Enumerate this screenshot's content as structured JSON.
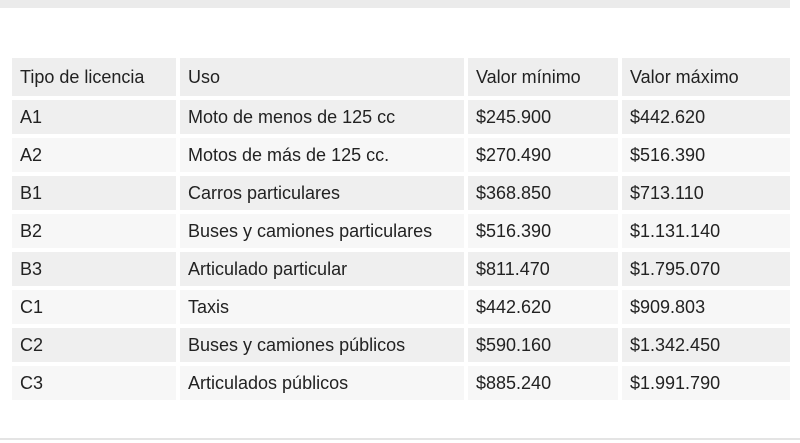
{
  "table": {
    "headers": [
      "Tipo de licencia",
      "Uso",
      "Valor mínimo",
      "Valor máximo"
    ],
    "rows": [
      [
        "A1",
        "Moto de menos de 125 cc",
        "$245.900",
        "$442.620"
      ],
      [
        "A2",
        "Motos de más de 125 cc.",
        "$270.490",
        "$516.390"
      ],
      [
        "B1",
        "Carros particulares",
        "$368.850",
        "$713.110"
      ],
      [
        "B2",
        "Buses y camiones particulares",
        "$516.390",
        "$1.131.140"
      ],
      [
        "B3",
        "Articulado particular",
        "$811.470",
        "$1.795.070"
      ],
      [
        "C1",
        "Taxis",
        "$442.620",
        "$909.803"
      ],
      [
        "C2",
        "Buses y camiones públicos",
        "$590.160",
        "$1.342.450"
      ],
      [
        "C3",
        "Articulados públicos",
        "$885.240",
        "$1.991.790"
      ]
    ]
  }
}
